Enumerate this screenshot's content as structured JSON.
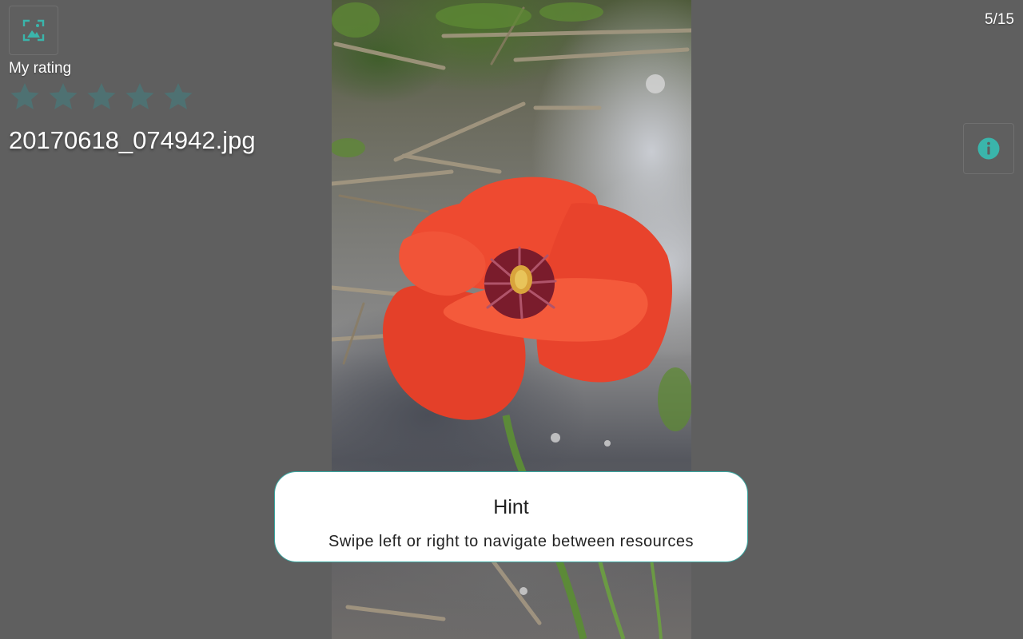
{
  "viewer": {
    "counter": "5/15",
    "rating_label": "My rating",
    "rating_value": 0,
    "rating_max": 5,
    "filename": "20170618_074942.jpg"
  },
  "icons": {
    "thumbnail": "image-frame-icon",
    "info": "info-icon",
    "star": "star-icon"
  },
  "hint": {
    "title": "Hint",
    "text": "Swipe left or right to navigate between resources"
  },
  "colors": {
    "background": "#5f5f5f",
    "accent": "#3ab5ab",
    "star_empty": "#4e7172",
    "hint_border": "#3aa6a0"
  }
}
